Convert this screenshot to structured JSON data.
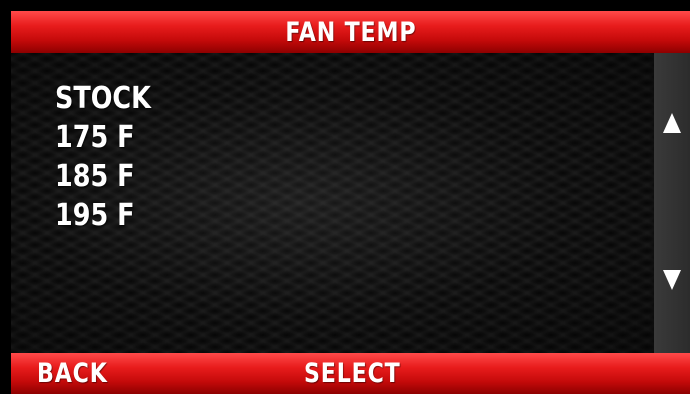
{
  "header": {
    "title": "FAN TEMP"
  },
  "menu": {
    "items": [
      {
        "label": "STOCK"
      },
      {
        "label": "175 F"
      },
      {
        "label": "185 F"
      },
      {
        "label": "195 F"
      }
    ]
  },
  "scroll": {
    "up_icon": "arrow-up-icon",
    "down_icon": "arrow-down-icon"
  },
  "footer": {
    "back_label": "BACK",
    "select_label": "SELECT"
  },
  "colors": {
    "accent": "#e81c1c",
    "background": "#1b1b1b",
    "text": "#ffffff"
  }
}
